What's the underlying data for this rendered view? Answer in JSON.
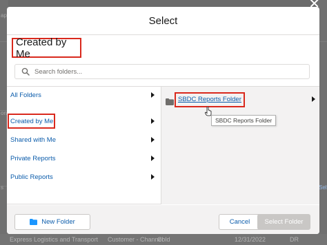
{
  "modal": {
    "title": "Select",
    "current_folder": "Created by Me"
  },
  "search": {
    "placeholder": "Search folders..."
  },
  "nav": {
    "items": [
      {
        "label": "All Folders"
      },
      {
        "label": "Created by Me"
      },
      {
        "label": "Shared with Me"
      },
      {
        "label": "Private Reports"
      },
      {
        "label": "Public Reports"
      }
    ],
    "selected": "Created by Me"
  },
  "folders": {
    "items": [
      {
        "label": "SBDC Reports Folder"
      }
    ],
    "tooltip": "SBDC Reports Folder"
  },
  "footer": {
    "new_folder_label": "New Folder",
    "cancel_label": "Cancel",
    "select_folder_label": "Select Folder"
  },
  "backdrop": {
    "row_text": [
      "Express Logistics and Transport",
      "Customer - Channel",
      "Cold",
      "12/31/2022",
      "DR"
    ],
    "left_fragments": [
      "ap",
      "on",
      "s"
    ],
    "right_fragment": "Sel"
  },
  "colors": {
    "highlight_border": "#d9281c",
    "link": "#0b5cab",
    "folder_icon": "#706e6b",
    "folder_button_icon": "#1b96ff"
  }
}
